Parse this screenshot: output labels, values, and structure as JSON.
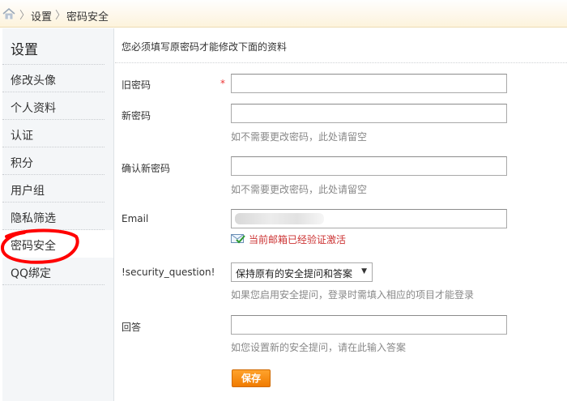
{
  "breadcrumb": {
    "home_icon": "home-icon",
    "items": [
      "设置",
      "密码安全"
    ]
  },
  "sidebar": {
    "title": "设置",
    "items": [
      {
        "label": "修改头像"
      },
      {
        "label": "个人资料"
      },
      {
        "label": "认证"
      },
      {
        "label": "积分"
      },
      {
        "label": "用户组"
      },
      {
        "label": "隐私筛选"
      },
      {
        "label": "密码安全",
        "active": true
      },
      {
        "label": "QQ绑定"
      }
    ]
  },
  "form": {
    "notice": "您必须填写原密码才能修改下面的资料",
    "old_password": {
      "label": "旧密码",
      "required_mark": "*",
      "value": ""
    },
    "new_password": {
      "label": "新密码",
      "value": "",
      "hint": "如不需要更改密码，此处请留空"
    },
    "confirm_password": {
      "label": "确认新密码",
      "value": "",
      "hint": "如不需要更改密码，此处请留空"
    },
    "email": {
      "label": "Email",
      "verified_text": "当前邮箱已经验证激活",
      "verified_icon": "mail-check-icon"
    },
    "security_question": {
      "label": "!security_question!",
      "selected": "保持原有的安全提问和答案",
      "hint": "如果您启用安全提问，登录时需填入相应的项目才能登录"
    },
    "answer": {
      "label": "回答",
      "value": "",
      "hint": "如您设置新的安全提问，请在此输入答案"
    },
    "save_label": "保存"
  },
  "colors": {
    "annotation_circle": "#ff0000",
    "save_button": "#f28a0e",
    "verified_text": "#cc3333"
  }
}
